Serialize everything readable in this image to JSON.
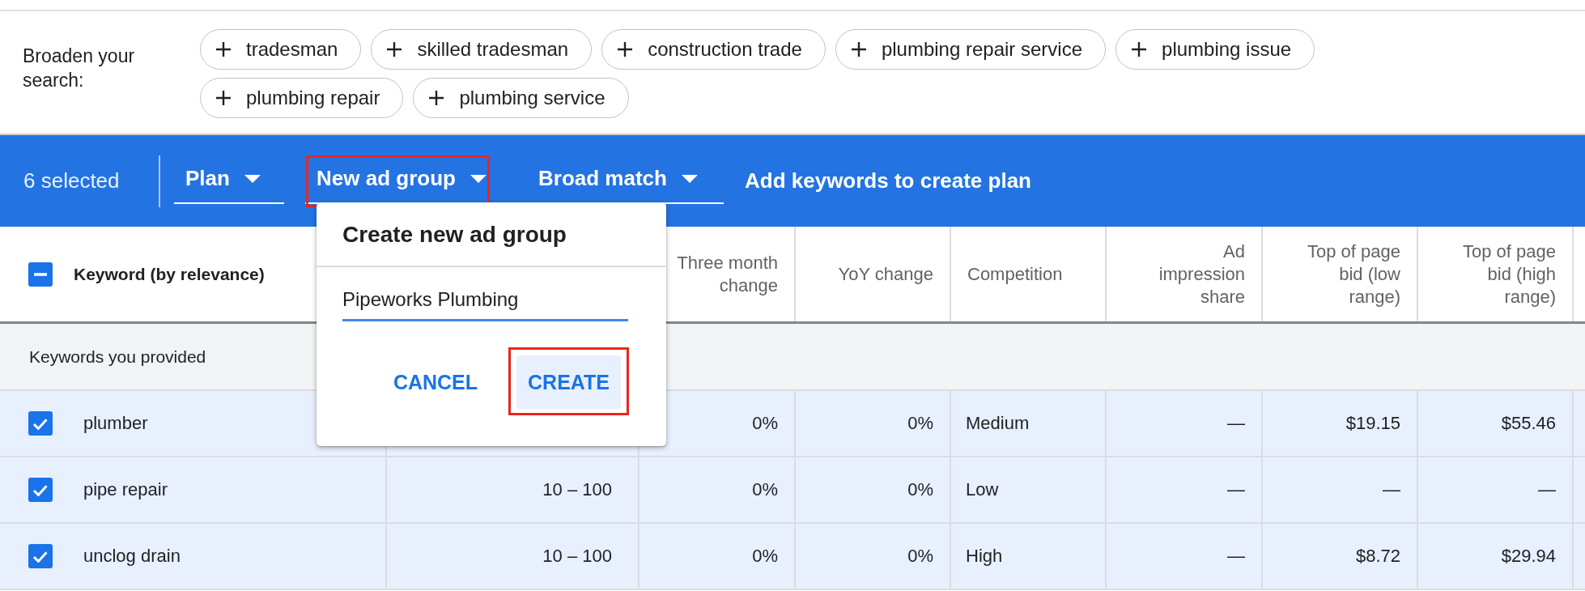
{
  "broaden": {
    "label": "Broaden your search:",
    "chips": [
      "tradesman",
      "skilled tradesman",
      "construction trade",
      "plumbing repair service",
      "plumbing issue",
      "plumbing repair",
      "plumbing service"
    ]
  },
  "toolbar": {
    "selection": "6 selected",
    "dropdowns": [
      {
        "label": "Plan",
        "highlighted": false
      },
      {
        "label": "New ad group",
        "highlighted": true
      },
      {
        "label": "Broad match",
        "highlighted": false
      }
    ],
    "hint": "Add keywords to create plan"
  },
  "table": {
    "select_all": {
      "checked": true,
      "partial": true
    },
    "columns": [
      "Keyword (by relevance)",
      null,
      "Three month change",
      "YoY change",
      "Competition",
      "Ad impression share",
      "Top of page bid (low range)",
      "Top of page bid (high range)",
      null
    ],
    "group": "Keywords you provided",
    "rows": [
      {
        "selected": true,
        "cells": [
          "plumber",
          null,
          "0%",
          "0%",
          "Medium",
          "—",
          "$19.15",
          "$55.46",
          null
        ]
      },
      {
        "selected": true,
        "cells": [
          "pipe repair",
          "10 – 100",
          "0%",
          "0%",
          "Low",
          "—",
          "—",
          "—",
          null
        ]
      },
      {
        "selected": true,
        "cells": [
          "unclog drain",
          "10 – 100",
          "0%",
          "0%",
          "High",
          "—",
          "$8.72",
          "$29.94",
          null
        ]
      }
    ]
  },
  "dialog": {
    "title": "Create new ad group",
    "value": "Pipeworks Plumbing",
    "buttons": [
      {
        "label": "CANCEL",
        "kind": "text",
        "highlighted": false
      },
      {
        "label": "CREATE",
        "kind": "filled",
        "highlighted": true
      }
    ]
  }
}
